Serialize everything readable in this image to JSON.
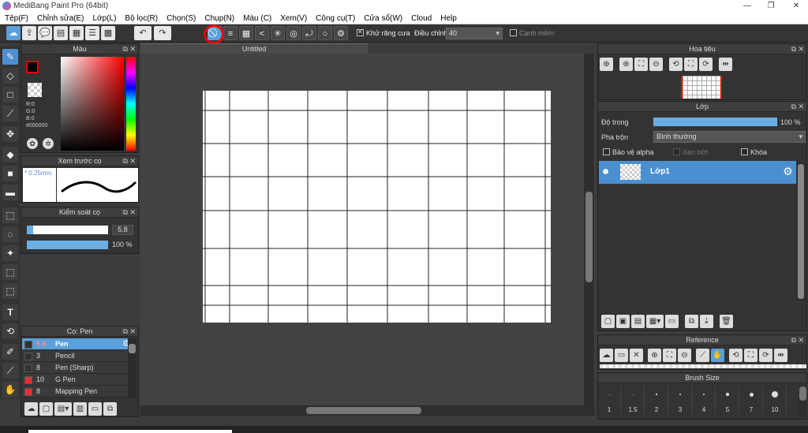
{
  "window": {
    "title": "MediBang Paint Pro (64bit)",
    "minimize": "—",
    "restore": "❐",
    "close": "✕"
  },
  "menu": [
    "Tệp(F)",
    "Chỉnh sửa(E)",
    "Lớp(L)",
    "Bộ lọc(R)",
    "Chọn(S)",
    "Chụp(N)",
    "Màu (C)",
    "Xem(V)",
    "Công cụ(T)",
    "Cửa sổ(W)",
    "Cloud",
    "Help"
  ],
  "toolbar": {
    "antialias_label": "Khử răng cưa",
    "adjust_label": "Điều chỉnh",
    "adjust_value": "40",
    "smooth_label": "Cạnh mềm"
  },
  "document": {
    "tab_title": "Untitled"
  },
  "color_panel": {
    "title": "Màu",
    "r": "R:0",
    "g": "G:0",
    "b": "B:0",
    "hex": "#000000",
    "accent": "#000000"
  },
  "brush_preview": {
    "title": "Xem trước cọ",
    "size": "0.25mm"
  },
  "brush_control": {
    "title": "Kiểm soát cọ",
    "size_value": "5.8",
    "opacity_value": "100 %",
    "opacity": 1.0,
    "size_fraction": 0.08
  },
  "brush_list": {
    "title": "Cọ: Pen",
    "items": [
      {
        "size": "5.8",
        "name": "Pen",
        "color": "#333333",
        "selected": true
      },
      {
        "size": "3",
        "name": "Pencil",
        "color": "#333333",
        "selected": false
      },
      {
        "size": "8",
        "name": "Pen (Sharp)",
        "color": "#333333",
        "selected": false
      },
      {
        "size": "10",
        "name": "G Pen",
        "color": "#e83030",
        "selected": false
      },
      {
        "size": "8",
        "name": "Mapping Pen",
        "color": "#e83030",
        "selected": false
      }
    ]
  },
  "navigator": {
    "title": "Hoa tiêu"
  },
  "layer_panel": {
    "title": "Lớp",
    "opacity_label": "Độ trong",
    "opacity_value": "100 %",
    "opacity": 1.0,
    "blend_label": "Pha trộn",
    "blend_value": "Bình thường",
    "protect_alpha": "Bảo vệ alpha",
    "clipping": "Xén bớt",
    "lock": "Khóa",
    "layers": [
      {
        "name": "Lớp1"
      }
    ]
  },
  "reference": {
    "title": "Reference"
  },
  "brush_size": {
    "title": "Brush Size",
    "sizes": [
      "1",
      "1.5",
      "2",
      "3",
      "4",
      "5",
      "7",
      "10"
    ]
  }
}
